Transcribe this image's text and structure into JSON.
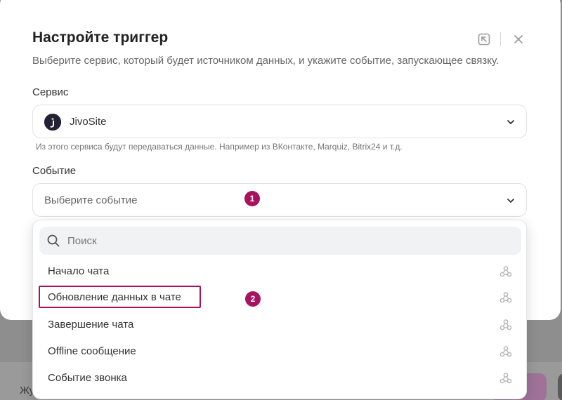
{
  "modal": {
    "title": "Настройте триггер",
    "subtitle": "Выберите сервис, который будет источником данных, и укажите событие, запускающее связку."
  },
  "service": {
    "label": "Сервис",
    "value": "JivoSite",
    "logo_letter": "j",
    "hint": "Из этого сервиса будут передаваться данные. Например из ВКонтакте, Marquiz, Bitrix24 и т.д."
  },
  "event": {
    "label": "Событие",
    "placeholder": "Выберите событие"
  },
  "dropdown": {
    "search_placeholder": "Поиск",
    "options": [
      {
        "label": "Начало чата"
      },
      {
        "label": "Обновление данных в чате"
      },
      {
        "label": "Завершение чата"
      },
      {
        "label": "Offline сообщение"
      },
      {
        "label": "Событие звонка"
      }
    ]
  },
  "annotations": {
    "badge_1": "1",
    "badge_2": "2"
  },
  "background": {
    "text_fragment": "Жу"
  },
  "colors": {
    "accent": "#a8135f",
    "logo_bg": "#242035",
    "overlay": "#8e8e8e"
  }
}
